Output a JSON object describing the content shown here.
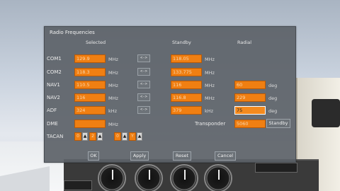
{
  "dialog": {
    "title": "Radio Frequencies",
    "headers": {
      "selected": "Selected",
      "standby": "Standby",
      "radial": "Radial"
    },
    "rows": [
      {
        "label": "COM1",
        "selected": "129.9",
        "sel_unit": "MHz",
        "swap": "<->",
        "standby": "118.05",
        "sby_unit": "MHz"
      },
      {
        "label": "COM2",
        "selected": "118.3",
        "sel_unit": "MHz",
        "swap": "<->",
        "standby": "133.775",
        "sby_unit": "MHz"
      },
      {
        "label": "NAV1",
        "selected": "110.5",
        "sel_unit": "MHz",
        "swap": "<->",
        "standby": "116",
        "sby_unit": "MHz",
        "radial": "60",
        "rad_unit": "deg"
      },
      {
        "label": "NAV2",
        "selected": "116",
        "sel_unit": "MHz",
        "swap": "<->",
        "standby": "116.8",
        "sby_unit": "MHz",
        "radial": "229",
        "rad_unit": "deg"
      },
      {
        "label": "ADF",
        "selected": "324",
        "sel_unit": "kHz",
        "swap": "<->",
        "standby": "379",
        "sby_unit": "kHz",
        "radial": "75",
        "rad_unit": "deg"
      }
    ],
    "dme": {
      "label": "DME",
      "value": "",
      "unit": "MHz"
    },
    "transponder": {
      "label": "Transponder",
      "value": "5060",
      "standby_button": "Standby"
    },
    "tacan": {
      "label": "TACAN",
      "digits": [
        "0",
        "2",
        "0",
        "Y"
      ]
    },
    "buttons": {
      "ok": "OK",
      "apply": "Apply",
      "reset": "Reset",
      "cancel": "Cancel"
    }
  },
  "colors": {
    "field": "#f07f12",
    "dialog_bg": "#5c6268"
  }
}
